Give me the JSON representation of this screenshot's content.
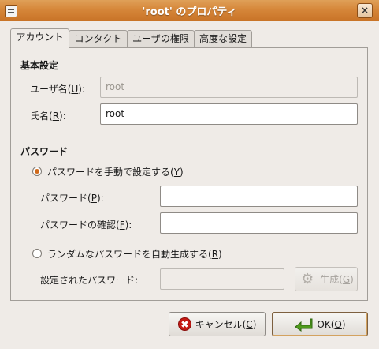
{
  "window": {
    "title": "'root' のプロパティ",
    "menu_icon": "window-menu-icon",
    "close_icon": "close-icon",
    "close_glyph": "×"
  },
  "tabs": [
    {
      "label": "アカウント",
      "active": true
    },
    {
      "label": "コンタクト",
      "active": false
    },
    {
      "label": "ユーザの権限",
      "active": false
    },
    {
      "label": "高度な設定",
      "active": false
    }
  ],
  "basic": {
    "section_title": "基本設定",
    "username": {
      "label_pre": "ユーザ名(",
      "mnemonic": "U",
      "label_post": "):",
      "value": "root"
    },
    "fullname": {
      "label_pre": "氏名(",
      "mnemonic": "R",
      "label_post": "):",
      "value": "root"
    }
  },
  "password": {
    "section_title": "パスワード",
    "manual_option": {
      "label_pre": "パスワードを手動で設定する(",
      "mnemonic": "Y",
      "label_post": ")",
      "checked": true
    },
    "password_field": {
      "label_pre": "パスワード(",
      "mnemonic": "P",
      "label_post": "):",
      "value": ""
    },
    "confirm_field": {
      "label_pre": "パスワードの確認(",
      "mnemonic": "F",
      "label_post": "):",
      "value": ""
    },
    "random_option": {
      "label_pre": "ランダムなパスワードを自動生成する(",
      "mnemonic": "R",
      "label_post": ")",
      "checked": false
    },
    "generated_field": {
      "label": "設定されたパスワード:",
      "value": ""
    },
    "generate_button": {
      "label_pre": "生成(",
      "mnemonic": "G",
      "label_post": ")",
      "icon": "gear-icon"
    }
  },
  "buttons": {
    "cancel": {
      "label_pre": "キャンセル(",
      "mnemonic": "C",
      "label_post": ")",
      "icon": "cancel-icon"
    },
    "ok": {
      "label_pre": "OK(",
      "mnemonic": "O",
      "label_post": ")",
      "icon": "ok-arrow-icon"
    }
  },
  "colors": {
    "titlebar": "#d6873a",
    "window_bg": "#efebe7",
    "radio_accent": "#d06a1c",
    "cancel_icon": "#c51a14",
    "ok_icon": "#4f9a1c"
  }
}
